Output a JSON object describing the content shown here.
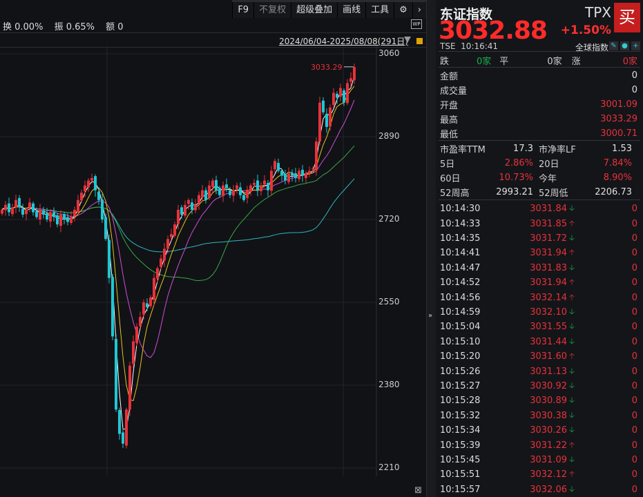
{
  "toolbar": {
    "items": [
      "F9",
      "不复权",
      "超级叠加",
      "画线",
      "工具"
    ],
    "settings_icon": "gear-icon",
    "more_icon": "chevron-right-icon"
  },
  "info": {
    "turnover": "换 0.00%",
    "amplitude": "振 0.65%",
    "amount": "额 0"
  },
  "wp_label": "WP",
  "range": "2024/06/04-2025/08/08(291日)",
  "chart_data": {
    "type": "candlestick",
    "y_ticks": [
      "3060",
      "2890",
      "2720",
      "2550",
      "2380",
      "2210"
    ],
    "ylim": [
      2210,
      3060
    ],
    "max_label": "3033.29",
    "closes": [
      2740,
      2750,
      2735,
      2745,
      2760,
      2745,
      2730,
      2740,
      2755,
      2735,
      2725,
      2740,
      2730,
      2720,
      2735,
      2725,
      2710,
      2730,
      2720,
      2715,
      2725,
      2740,
      2760,
      2775,
      2790,
      2800,
      2805,
      2780,
      2760,
      2720,
      2680,
      2600,
      2480,
      2330,
      2280,
      2260,
      2330,
      2420,
      2470,
      2500,
      2520,
      2550,
      2540,
      2560,
      2600,
      2620,
      2640,
      2660,
      2680,
      2690,
      2710,
      2740,
      2730,
      2750,
      2760,
      2740,
      2750,
      2770,
      2780,
      2760,
      2790,
      2800,
      2780,
      2770,
      2790,
      2785,
      2770,
      2780,
      2790,
      2770,
      2760,
      2780,
      2790,
      2795,
      2780,
      2790,
      2800,
      2780,
      2820,
      2840,
      2820,
      2810,
      2800,
      2815,
      2810,
      2805,
      2820,
      2810,
      2815,
      2820,
      2825,
      2880,
      2960,
      2940,
      2910,
      2950,
      2980,
      2970,
      2990,
      2960,
      3000,
      3010,
      3032.88
    ],
    "colors": {
      "up": "#e8323a",
      "down": "#1fc7d4",
      "ma5": "#ffffff",
      "ma10": "#e8c21a",
      "ma20": "#d14fd6",
      "ma60": "#39a845",
      "ma120": "#2fb8c0"
    }
  },
  "quote": {
    "name": "东证指数",
    "price": "3032.88",
    "code": "TPX",
    "change_pct": "+1.50%",
    "buy": "买",
    "exchange": "TSE",
    "time": "10:16:41",
    "global": "全球指数"
  },
  "breadth": {
    "down_label": "跌",
    "down": "0家",
    "flat_label": "平",
    "flat": "0家",
    "up_label": "涨",
    "up": "0家"
  },
  "stats": [
    {
      "label": "金额",
      "value": "0",
      "c": "wht"
    },
    {
      "label": "成交量",
      "value": "0",
      "c": "wht"
    },
    {
      "label": "开盘",
      "value": "3001.09",
      "c": "red"
    },
    {
      "label": "最高",
      "value": "3033.29",
      "c": "red"
    },
    {
      "label": "最低",
      "value": "3000.71",
      "c": "red"
    }
  ],
  "metrics": [
    [
      {
        "label": "市盈率TTM",
        "value": "17.3",
        "c": "wht"
      },
      {
        "label": "市净率LF",
        "value": "1.53",
        "c": "wht"
      }
    ],
    [
      {
        "label": "5日",
        "value": "2.86%",
        "c": "red"
      },
      {
        "label": "20日",
        "value": "7.84%",
        "c": "red"
      }
    ],
    [
      {
        "label": "60日",
        "value": "10.73%",
        "c": "red"
      },
      {
        "label": "今年",
        "value": "8.90%",
        "c": "red"
      }
    ],
    [
      {
        "label": "52周高",
        "value": "2993.21",
        "c": "wht"
      },
      {
        "label": "52周低",
        "value": "2206.73",
        "c": "wht"
      }
    ]
  ],
  "ticks": [
    {
      "time": "10:14:30",
      "price": "3031.84",
      "dir": "down",
      "vol": "0"
    },
    {
      "time": "10:14:33",
      "price": "3031.85",
      "dir": "up",
      "vol": "0"
    },
    {
      "time": "10:14:35",
      "price": "3031.72",
      "dir": "down",
      "vol": "0"
    },
    {
      "time": "10:14:41",
      "price": "3031.94",
      "dir": "up",
      "vol": "0"
    },
    {
      "time": "10:14:47",
      "price": "3031.83",
      "dir": "down",
      "vol": "0"
    },
    {
      "time": "10:14:52",
      "price": "3031.94",
      "dir": "up",
      "vol": "0"
    },
    {
      "time": "10:14:56",
      "price": "3032.14",
      "dir": "up",
      "vol": "0"
    },
    {
      "time": "10:14:59",
      "price": "3032.10",
      "dir": "down",
      "vol": "0"
    },
    {
      "time": "10:15:04",
      "price": "3031.55",
      "dir": "down",
      "vol": "0"
    },
    {
      "time": "10:15:10",
      "price": "3031.44",
      "dir": "down",
      "vol": "0"
    },
    {
      "time": "10:15:20",
      "price": "3031.60",
      "dir": "up",
      "vol": "0"
    },
    {
      "time": "10:15:26",
      "price": "3031.13",
      "dir": "down",
      "vol": "0"
    },
    {
      "time": "10:15:27",
      "price": "3030.92",
      "dir": "down",
      "vol": "0"
    },
    {
      "time": "10:15:28",
      "price": "3030.89",
      "dir": "down",
      "vol": "0"
    },
    {
      "time": "10:15:32",
      "price": "3030.38",
      "dir": "down",
      "vol": "0"
    },
    {
      "time": "10:15:34",
      "price": "3030.26",
      "dir": "down",
      "vol": "0"
    },
    {
      "time": "10:15:39",
      "price": "3031.22",
      "dir": "up",
      "vol": "0"
    },
    {
      "time": "10:15:45",
      "price": "3031.09",
      "dir": "down",
      "vol": "0"
    },
    {
      "time": "10:15:51",
      "price": "3032.12",
      "dir": "up",
      "vol": "0"
    },
    {
      "time": "10:15:57",
      "price": "3032.06",
      "dir": "down",
      "vol": "0"
    }
  ]
}
